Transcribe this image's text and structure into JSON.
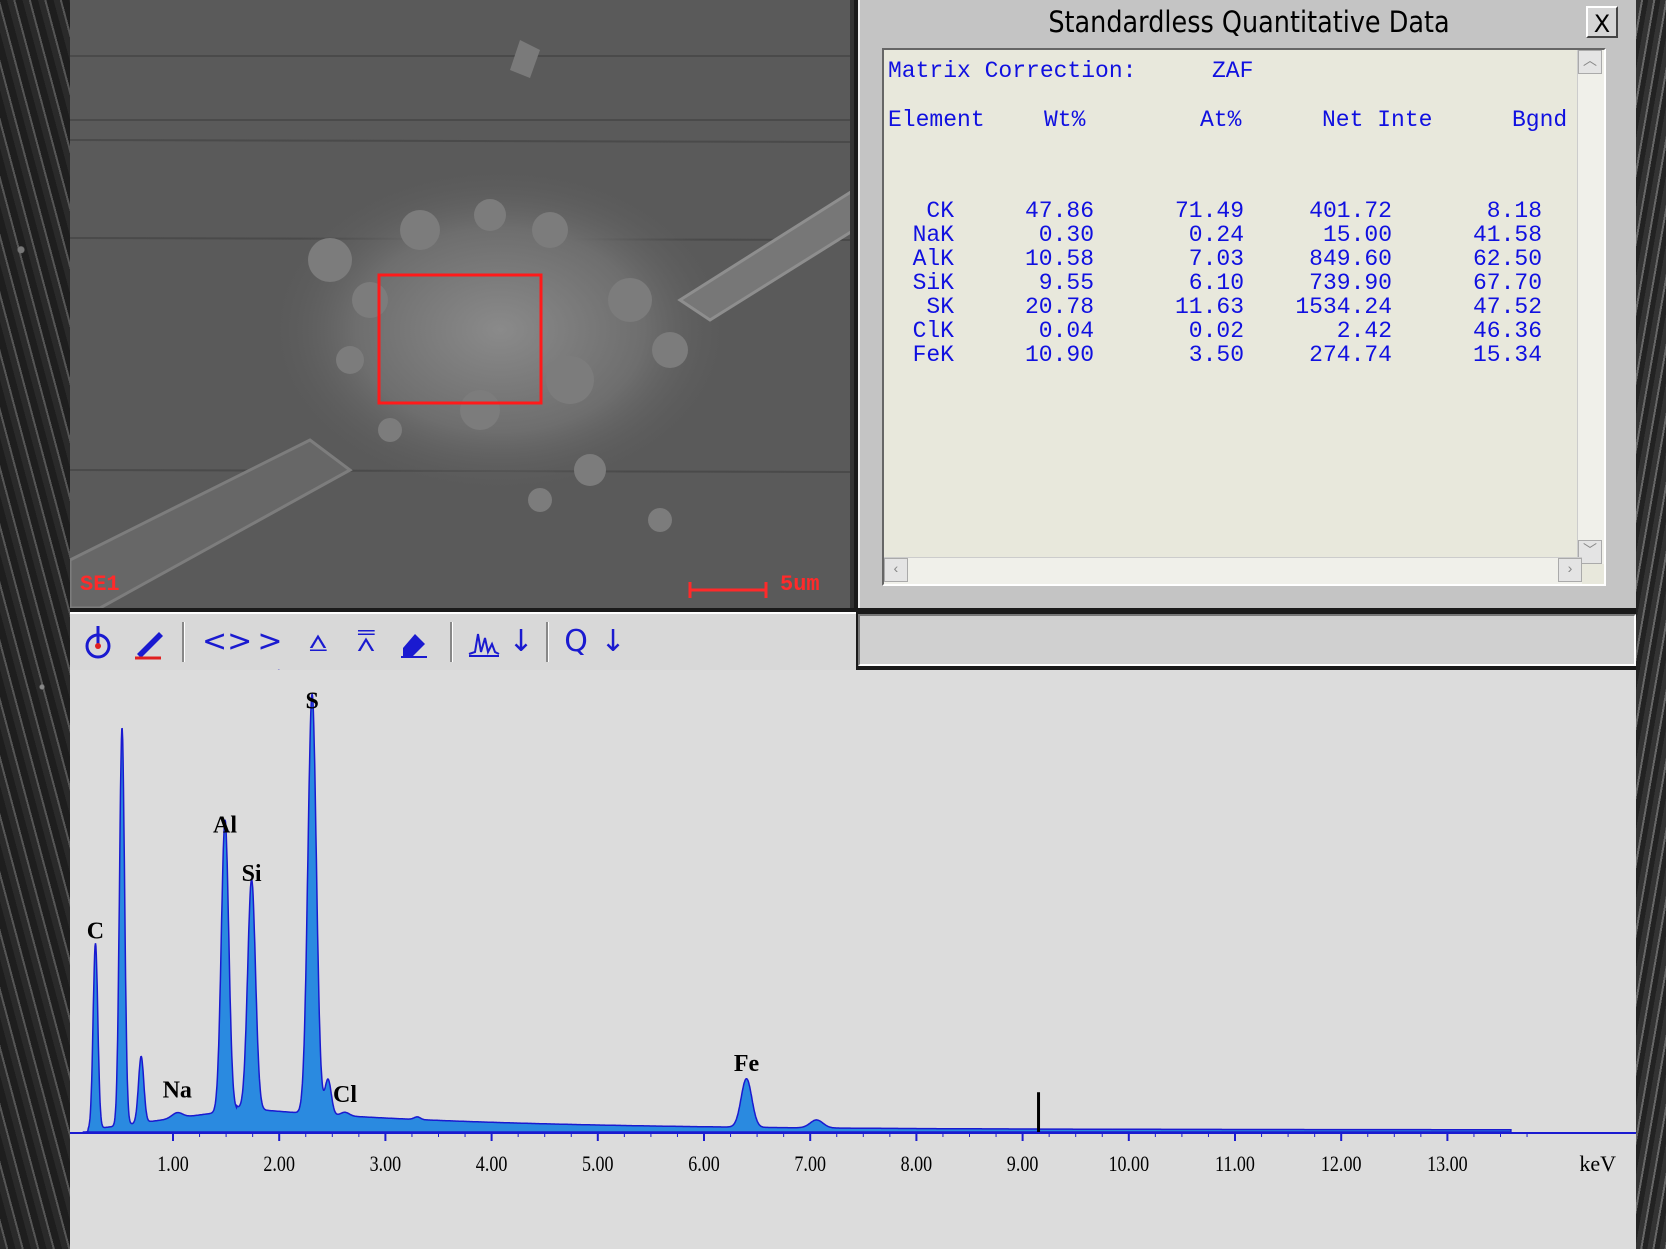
{
  "sem_image": {
    "detector_label": "SE1",
    "scale_label": "5um"
  },
  "quant_window": {
    "title": "Standardless Quantitative Data",
    "close_label": "X",
    "matrix_label": "Matrix Correction:",
    "matrix_value": "ZAF",
    "headers": [
      "Element",
      "Wt%",
      "At%",
      "Net Inte",
      "Bgnd"
    ],
    "rows": [
      [
        "CK",
        "47.86",
        "71.49",
        "401.72",
        "8.18"
      ],
      [
        "NaK",
        "0.30",
        "0.24",
        "15.00",
        "41.58"
      ],
      [
        "AlK",
        "10.58",
        "7.03",
        "849.60",
        "62.50"
      ],
      [
        "SiK",
        "9.55",
        "6.10",
        "739.90",
        "67.70"
      ],
      [
        "SK",
        "20.78",
        "11.63",
        "1534.24",
        "47.52"
      ],
      [
        "ClK",
        "0.04",
        "0.02",
        "2.42",
        "46.36"
      ],
      [
        "FeK",
        "10.90",
        "3.50",
        "274.74",
        "15.34"
      ]
    ]
  },
  "toolbar": {
    "icons": [
      "info-marker-icon",
      "edit-marker-icon",
      "expand-horizontal-icon",
      "compress-horizontal-icon",
      "expand-vertical-icon",
      "compress-vertical-icon",
      "erase-icon",
      "spectrum-icon",
      "down-arrow-icon",
      "zoom-icon",
      "down-arrow-icon"
    ]
  },
  "chart_data": {
    "type": "line",
    "xlabel": "keV",
    "xlim": [
      0,
      13.6
    ],
    "ylim": [
      0,
      100
    ],
    "x_ticks": [
      "1.00",
      "2.00",
      "3.00",
      "4.00",
      "5.00",
      "6.00",
      "7.00",
      "8.00",
      "9.00",
      "10.00",
      "11.00",
      "12.00",
      "13.00"
    ],
    "peak_labels": [
      {
        "label": "C",
        "x": 0.27,
        "y": 42
      },
      {
        "label": "Na",
        "x": 1.04,
        "y": 6
      },
      {
        "label": "Al",
        "x": 1.49,
        "y": 66
      },
      {
        "label": "Si",
        "x": 1.74,
        "y": 55
      },
      {
        "label": "S",
        "x": 2.31,
        "y": 94
      },
      {
        "label": "Cl",
        "x": 2.62,
        "y": 5
      },
      {
        "label": "Fe",
        "x": 6.4,
        "y": 12
      }
    ],
    "peaks": [
      {
        "x": 0.27,
        "y": 42,
        "w": 0.022
      },
      {
        "x": 0.52,
        "y": 90,
        "w": 0.024
      },
      {
        "x": 0.7,
        "y": 15,
        "w": 0.025
      },
      {
        "x": 1.04,
        "y": 1.2,
        "w": 0.05
      },
      {
        "x": 1.49,
        "y": 66,
        "w": 0.035
      },
      {
        "x": 1.74,
        "y": 52,
        "w": 0.037
      },
      {
        "x": 2.31,
        "y": 95,
        "w": 0.04
      },
      {
        "x": 2.46,
        "y": 8,
        "w": 0.03
      },
      {
        "x": 2.62,
        "y": 0.8,
        "w": 0.04
      },
      {
        "x": 3.3,
        "y": 0.6,
        "w": 0.03
      },
      {
        "x": 6.4,
        "y": 11,
        "w": 0.05
      },
      {
        "x": 7.06,
        "y": 1.8,
        "w": 0.06
      }
    ],
    "marker_x": 9.15,
    "marker_height": 9
  }
}
